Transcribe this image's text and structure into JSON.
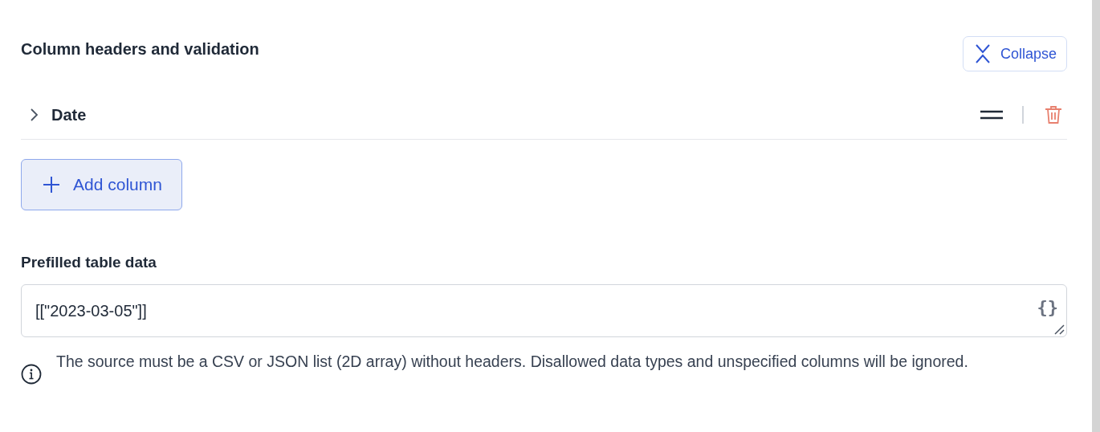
{
  "section": {
    "title": "Column headers and validation",
    "collapse_button": "Collapse"
  },
  "columns": [
    {
      "name": "Date",
      "expanded": false
    }
  ],
  "add_column_button": "Add column",
  "prefilled": {
    "label": "Prefilled table data",
    "value": "[[\"2023-03-05\"]]",
    "format_icon": "{}"
  },
  "help_text": "The source must be a CSV or JSON list (2D array) without headers. Disallowed data types and unspecified columns will be ignored."
}
